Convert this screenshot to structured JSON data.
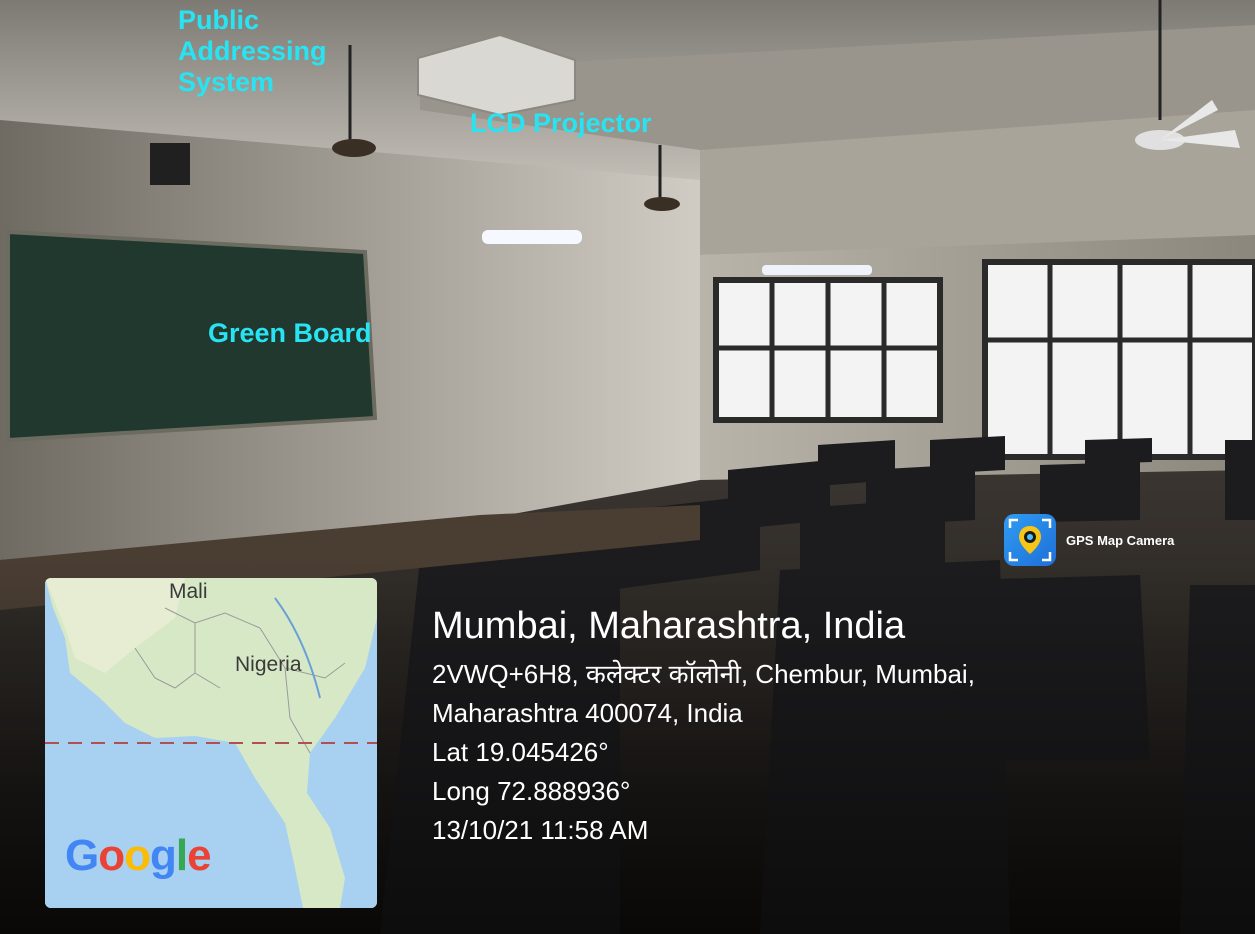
{
  "annotations": {
    "public_addressing": "Public Addressing System",
    "lcd_projector": "LCD Projector",
    "green_board": "Green Board"
  },
  "map": {
    "labels": {
      "mali": "Mali",
      "nigeria": "Nigeria"
    },
    "logo_letters": [
      "G",
      "o",
      "o",
      "g",
      "l",
      "e"
    ],
    "logo_colors": [
      "#4285F4",
      "#EA4335",
      "#FBBC05",
      "#4285F4",
      "#34A853",
      "#EA4335"
    ]
  },
  "geotag": {
    "city": "Mumbai, Maharashtra, India",
    "address_line1": "2VWQ+6H8, कलेक्टर कॉलोनी, Chembur, Mumbai,",
    "address_line2": "Maharashtra 400074, India",
    "lat": "Lat 19.045426°",
    "long": "Long 72.888936°",
    "datetime": "13/10/21 11:58 AM"
  },
  "badge": {
    "app_name": "GPS Map Camera",
    "icon": "gps-pin-icon"
  },
  "colors": {
    "annotation": "#28e4f2",
    "text": "#ffffff"
  }
}
